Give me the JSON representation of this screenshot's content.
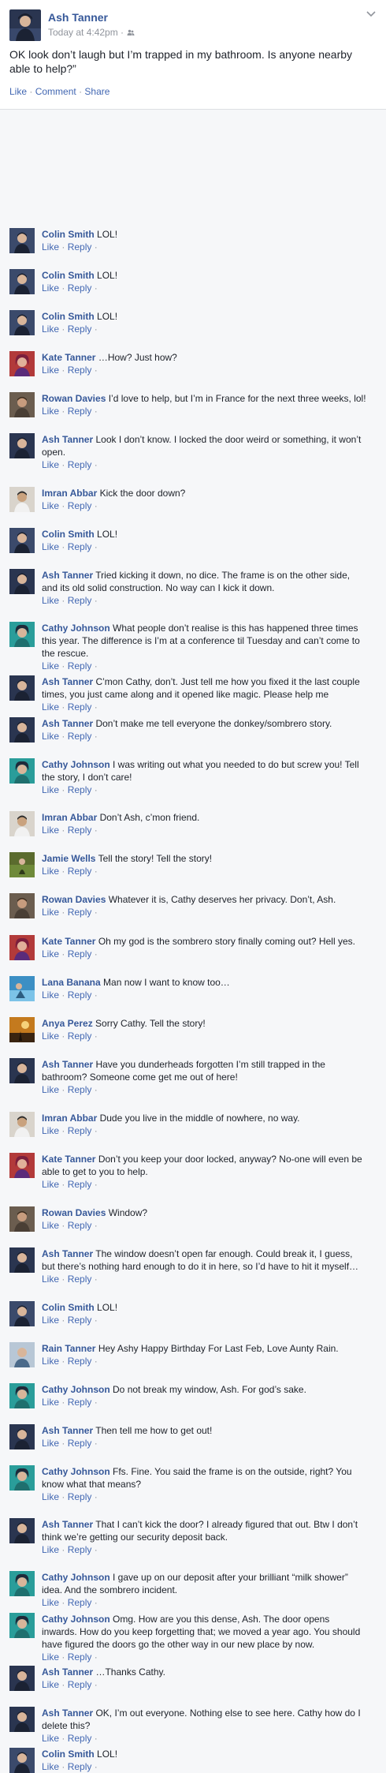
{
  "post": {
    "author": "Ash Tanner",
    "timestamp": "Today at 4:42pm ·",
    "audience_icon": "friends-icon",
    "text": "OK look don’t laugh but I’m trapped in my bathroom. Is anyone nearby able to help?”",
    "actions": {
      "like": "Like",
      "comment": "Comment",
      "share": "Share",
      "separator": "·"
    }
  },
  "comment_actions": {
    "like": "Like",
    "reply": "Reply",
    "separator": "·"
  },
  "people": {
    "colin": {
      "name": "Colin Smith",
      "color": "#3b4a6b"
    },
    "kate": {
      "name": "Kate Tanner",
      "color": "#b23a3a"
    },
    "rowan": {
      "name": "Rowan Davies",
      "color": "#6b5d4f"
    },
    "ash": {
      "name": "Ash Tanner",
      "color": "#2a3550"
    },
    "imran": {
      "name": "Imran Abbar",
      "color": "#d9d4cc"
    },
    "cathy": {
      "name": "Cathy Johnson",
      "color": "#2a9d9a"
    },
    "jamie": {
      "name": "Jamie Wells",
      "color": "#5b6b2e"
    },
    "lana": {
      "name": "Lana Banana",
      "color": "#3c8fc4"
    },
    "anya": {
      "name": "Anya Perez",
      "color": "#c47a1e"
    },
    "rain": {
      "name": "Rain Tanner",
      "color": "#7a8fa8"
    }
  },
  "comments": [
    {
      "author": "Colin Smith",
      "text": "LOL!"
    },
    {
      "author": "Colin Smith",
      "text": "LOL!"
    },
    {
      "author": "Colin Smith",
      "text": "LOL!"
    },
    {
      "author": "Kate Tanner",
      "text": "…How? Just how?"
    },
    {
      "author": "Rowan Davies",
      "text": "I’d love to help, but I’m in France for the next three weeks, lol!"
    },
    {
      "author": "Ash Tanner",
      "text": "Look I don’t know. I locked the door weird or something, it won’t open."
    },
    {
      "author": "Imran Abbar",
      "text": "Kick the door down?"
    },
    {
      "author": "Colin Smith",
      "text": "LOL!"
    },
    {
      "author": "Ash Tanner",
      "text": "Tried kicking it down, no dice. The frame is on the other side, and its old solid construction. No way can I kick it down."
    },
    {
      "author": "Cathy Johnson",
      "text": "What people don’t realise is this has happened three times this year. The difference is I’m at a conference til Tuesday and can’t come to the rescue."
    },
    {
      "author": "Ash Tanner",
      "text": "C’mon Cathy, don’t. Just tell me how you fixed it the last couple times, you just came along and it opened like magic. Please help me"
    },
    {
      "author": "Ash Tanner",
      "text": "Don’t make me tell everyone the donkey/sombrero story."
    },
    {
      "author": "Cathy Johnson",
      "text": "I was writing out what you needed to do but screw you! Tell the story, I don’t care!"
    },
    {
      "author": "Imran Abbar",
      "text": "Don’t Ash, c’mon friend."
    },
    {
      "author": "Jamie Wells",
      "text": "Tell the story! Tell the story!"
    },
    {
      "author": "Rowan Davies",
      "text": "Whatever it is, Cathy deserves her privacy. Don’t, Ash."
    },
    {
      "author": "Kate Tanner",
      "text": "Oh my god is the sombrero story finally coming out? Hell yes."
    },
    {
      "author": "Lana Banana",
      "text": "Man now I want to know too…"
    },
    {
      "author": "Anya Perez",
      "text": "Sorry Cathy. Tell the story!"
    },
    {
      "author": "Ash Tanner",
      "text": "Have you dunderheads forgotten I’m still trapped in the bathroom? Someone come get me out of here!"
    },
    {
      "author": "Imran Abbar",
      "text": "Dude you live in the middle of nowhere, no way."
    },
    {
      "author": "Kate Tanner",
      "text": "Don’t you keep your door locked, anyway? No-one will even be able to get to you to help."
    },
    {
      "author": "Rowan Davies",
      "text": "Window?"
    },
    {
      "author": "Ash Tanner",
      "text": "The window doesn’t open far enough. Could break it, I guess, but there’s nothing hard enough to do it in here, so I’d have to hit it myself…"
    },
    {
      "author": "Colin Smith",
      "text": "LOL!"
    },
    {
      "author": "Rain Tanner",
      "text": "Hey Ashy Happy Birthday For Last Feb, Love Aunty Rain."
    },
    {
      "author": "Cathy Johnson",
      "text": "Do not break my window, Ash. For god’s sake."
    },
    {
      "author": "Ash Tanner",
      "text": "Then tell me how to get out!"
    },
    {
      "author": "Cathy Johnson",
      "text": "Ffs. Fine. You said the frame is on the outside, right? You know what that means?"
    },
    {
      "author": "Ash Tanner",
      "text": "That I can’t kick the door? I already figured that out. Btw I don’t think we’re getting our security deposit back."
    },
    {
      "author": "Cathy Johnson",
      "text": "I gave up on our deposit after your brilliant “milk shower” idea. And the sombrero incident."
    },
    {
      "author": "Cathy Johnson",
      "text": "Omg. How are you this dense, Ash. The door opens inwards. How do you keep forgetting that; we moved a year ago. You should have figured the doors go the other way in our new place by now."
    },
    {
      "author": "Ash Tanner",
      "text": "…Thanks Cathy."
    },
    {
      "author": "Ash Tanner",
      "text": "OK, I’m out everyone. Nothing else to see here. Cathy how do I delete this?"
    },
    {
      "author": "Colin Smith",
      "text": "LOL!"
    }
  ]
}
